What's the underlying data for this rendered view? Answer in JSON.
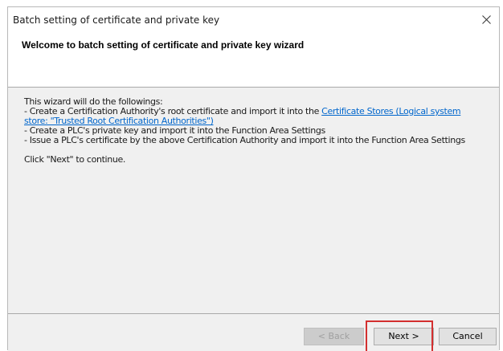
{
  "window": {
    "title": "Batch setting of certificate and private key"
  },
  "header": {
    "title": "Welcome to batch setting of certificate and private key wizard"
  },
  "content": {
    "intro": "This wizard will do the followings:",
    "item1_prefix": "- Create a Certification Authority's root certificate and import it into the ",
    "item1_link_part1": "Certificate Stores (Logical system",
    "item1_link_part2": "store: \"Trusted Root Certification Authorities\")",
    "item2": "- Create a PLC's private key and import it into the Function Area Settings",
    "item3": "- Issue a PLC's certificate by the above Certification Authority and import it into the Function Area Settings",
    "continue_text": "Click \"Next\" to continue."
  },
  "buttons": {
    "back": "< Back",
    "next": "Next >",
    "cancel": "Cancel"
  },
  "colors": {
    "highlight": "#d32f2f",
    "link": "#0066cc"
  },
  "icons": {
    "close": "close-icon"
  }
}
